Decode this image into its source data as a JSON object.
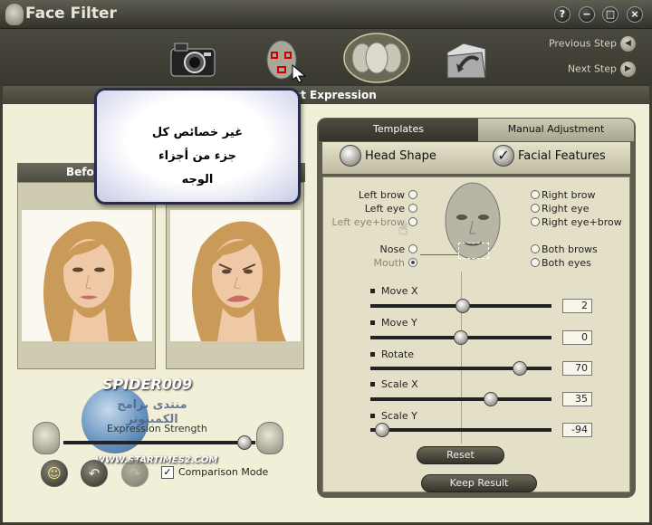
{
  "app": {
    "title": "Face Filter"
  },
  "window_buttons": [
    "?",
    "−",
    "□",
    "×"
  ],
  "wizard": {
    "previous_step": "Previous Step",
    "next_step": "Next Step",
    "steps": [
      "camera",
      "face-select",
      "expression",
      "export"
    ]
  },
  "section": {
    "title_visible": "ct Expression"
  },
  "before": {
    "label": "Befo"
  },
  "tooltip": {
    "text": "غير خصائص كل جزء من أجزاء الوجه"
  },
  "watermark": {
    "spider": "SPIDER009",
    "arabic": "منتدى برامج الكمبيوتر",
    "url": "WWW.STARTIMES2.COM"
  },
  "strength": {
    "label": "Expression Strength",
    "level": 0.95
  },
  "comparison": {
    "label": "Comparison Mode",
    "checked": true
  },
  "panel": {
    "tabs": {
      "templates": "Templates",
      "manual": "Manual Adjustment"
    },
    "options": {
      "head_shape": "Head Shape",
      "facial_features": "Facial Features"
    },
    "left_radios": [
      {
        "label": "Left brow",
        "selected": false
      },
      {
        "label": "Left eye",
        "selected": false
      },
      {
        "label": "Left eye+brow",
        "selected": false
      },
      {
        "label": "Nose",
        "selected": false
      },
      {
        "label": "Mouth",
        "selected": true
      }
    ],
    "right_radios": [
      {
        "label": "Right brow",
        "selected": false
      },
      {
        "label": "Right eye",
        "selected": false
      },
      {
        "label": "Right eye+brow",
        "selected": false
      },
      {
        "label": "Both brows",
        "selected": false
      },
      {
        "label": "Both eyes",
        "selected": false
      }
    ],
    "sliders": [
      {
        "label": "Move X",
        "value": "2"
      },
      {
        "label": "Move Y",
        "value": "0"
      },
      {
        "label": "Rotate",
        "value": "70"
      },
      {
        "label": "Scale X",
        "value": "35"
      },
      {
        "label": "Scale Y",
        "value": "-94"
      }
    ],
    "reset": "Reset",
    "keep_result": "Keep Result"
  }
}
